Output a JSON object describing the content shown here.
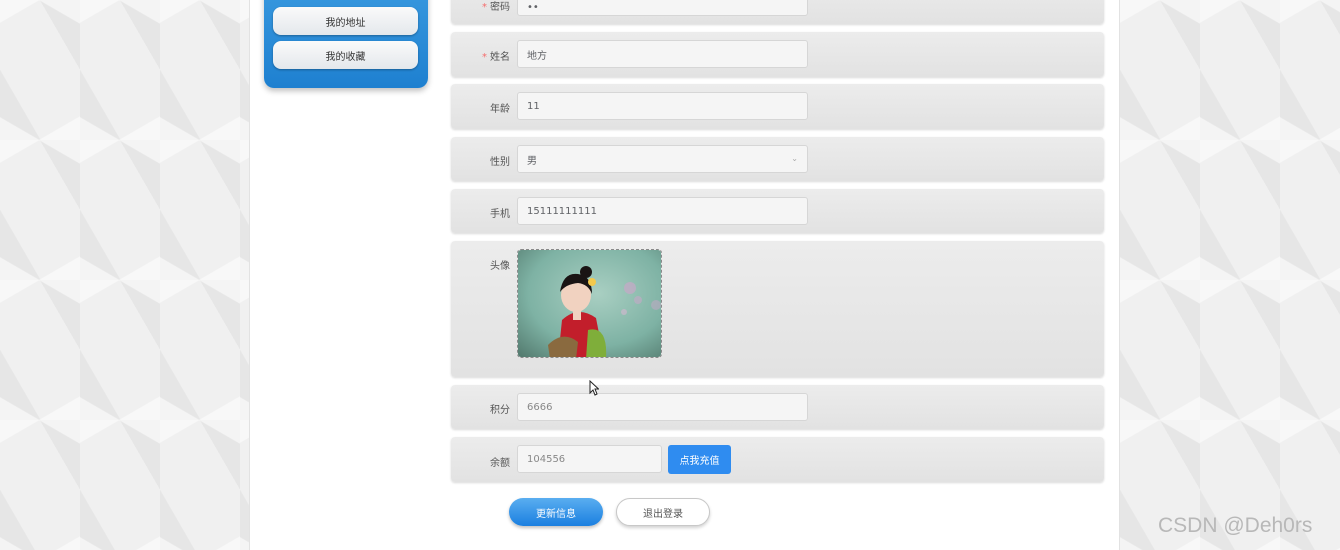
{
  "sidebar": {
    "items": [
      {
        "label": "我的地址"
      },
      {
        "label": "我的收藏"
      }
    ]
  },
  "form": {
    "password": {
      "label": "密码",
      "value": "••"
    },
    "name": {
      "label": "姓名",
      "value": "地方"
    },
    "age": {
      "label": "年龄",
      "value": "11"
    },
    "gender": {
      "label": "性别",
      "value": "男"
    },
    "phone": {
      "label": "手机",
      "value": "15111111111"
    },
    "avatar": {
      "label": "头像"
    },
    "points": {
      "label": "积分",
      "value": "6666"
    },
    "balance": {
      "label": "余额",
      "value": "104556",
      "recharge_label": "点我充值"
    },
    "required_mark": "*"
  },
  "actions": {
    "update_label": "更新信息",
    "logout_label": "退出登录"
  },
  "watermark": "CSDN @Deh0rs",
  "colors": {
    "accent": "#2f8cf0",
    "required": "#f56c6c",
    "sidebar": "#1e80d0"
  }
}
